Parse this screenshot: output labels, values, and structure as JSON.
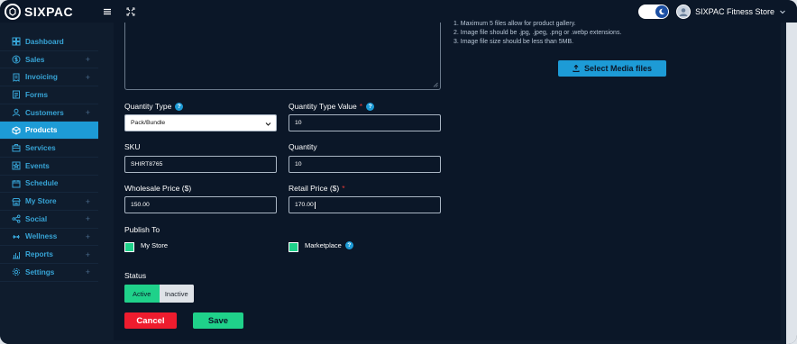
{
  "brand": {
    "name": "SIXPAC"
  },
  "header": {
    "store_name": "SIXPAC Fitness Store"
  },
  "sidebar": {
    "items": [
      {
        "label": "Dashboard",
        "icon": "dashboard-icon",
        "has_plus": false,
        "active": false
      },
      {
        "label": "Sales",
        "icon": "dollar-icon",
        "has_plus": true,
        "active": false
      },
      {
        "label": "Invoicing",
        "icon": "invoice-icon",
        "has_plus": true,
        "active": false
      },
      {
        "label": "Forms",
        "icon": "form-icon",
        "has_plus": false,
        "active": false
      },
      {
        "label": "Customers",
        "icon": "user-icon",
        "has_plus": true,
        "active": false
      },
      {
        "label": "Products",
        "icon": "box-icon",
        "has_plus": false,
        "active": true
      },
      {
        "label": "Services",
        "icon": "services-icon",
        "has_plus": false,
        "active": false
      },
      {
        "label": "Events",
        "icon": "star-icon",
        "has_plus": false,
        "active": false
      },
      {
        "label": "Schedule",
        "icon": "calendar-icon",
        "has_plus": false,
        "active": false
      },
      {
        "label": "My Store",
        "icon": "store-icon",
        "has_plus": true,
        "active": false
      },
      {
        "label": "Social",
        "icon": "social-icon",
        "has_plus": true,
        "active": false
      },
      {
        "label": "Wellness",
        "icon": "wellness-icon",
        "has_plus": true,
        "active": false
      },
      {
        "label": "Reports",
        "icon": "chart-icon",
        "has_plus": true,
        "active": false
      },
      {
        "label": "Settings",
        "icon": "gear-icon",
        "has_plus": true,
        "active": false
      }
    ],
    "plus_glyph": "+"
  },
  "media": {
    "notes": [
      "1. Maximum 5 files allow for product gallery.",
      "2. Image file should be .jpg, .jpeg, .png or .webp extensions.",
      "3. Image file size should be less than 5MB."
    ],
    "button_label": "Select Media files"
  },
  "form": {
    "quantity_type": {
      "label": "Quantity Type",
      "help": "?",
      "value": "Pack/Bundle"
    },
    "quantity_type_value": {
      "label": "Quantity Type Value",
      "required": "*",
      "help": "?",
      "value": "10"
    },
    "sku": {
      "label": "SKU",
      "value": "SHIRT8765"
    },
    "quantity": {
      "label": "Quantity",
      "value": "10"
    },
    "wholesale_price": {
      "label": "Wholesale Price ($)",
      "value": "150.00"
    },
    "retail_price": {
      "label": "Retail Price ($)",
      "required": "*",
      "value": "170.00"
    },
    "publish_to": {
      "label": "Publish To",
      "my_store": {
        "label": "My Store",
        "checked": true
      },
      "marketplace": {
        "label": "Marketplace",
        "checked": true,
        "help": "?"
      }
    },
    "status": {
      "label": "Status",
      "active": "Active",
      "inactive": "Inactive",
      "selected": "Active"
    }
  },
  "actions": {
    "cancel": "Cancel",
    "save": "Save"
  },
  "colors": {
    "accent": "#1d9bd6",
    "success": "#1fd18a",
    "danger": "#ee1c2e",
    "background": "#0b1728"
  }
}
